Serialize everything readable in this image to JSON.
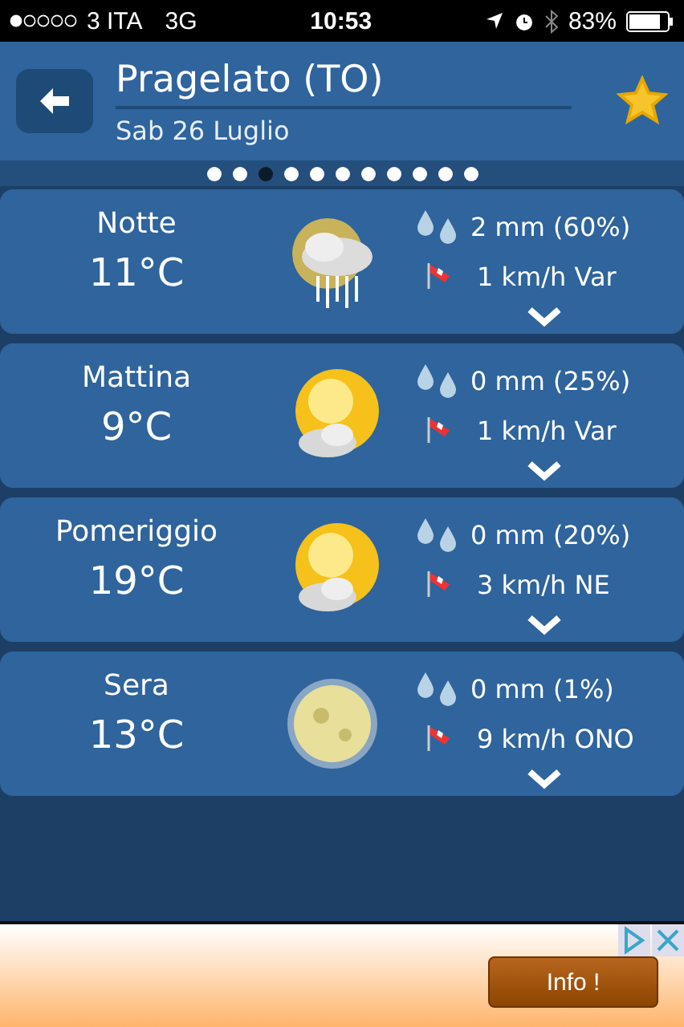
{
  "status_bar": {
    "carrier": "3 ITA",
    "network": "3G",
    "time": "10:53",
    "battery": "83%"
  },
  "header": {
    "title": "Pragelato (TO)",
    "date": "Sab 26 Luglio",
    "favorite": true
  },
  "pages": [
    {
      "selected": false
    },
    {
      "selected": false
    },
    {
      "selected": true
    },
    {
      "selected": false
    },
    {
      "selected": false
    },
    {
      "selected": false
    },
    {
      "selected": false
    },
    {
      "selected": false
    },
    {
      "selected": false
    },
    {
      "selected": false
    },
    {
      "selected": false
    }
  ],
  "periods": [
    {
      "name": "Notte",
      "temperature": "11°C",
      "kind": "moon-rain",
      "rain": "2 mm (60%)",
      "wind": "1 km/h Var"
    },
    {
      "name": "Mattina",
      "temperature": "9°C",
      "kind": "sun-cloud",
      "rain": "0 mm (25%)",
      "wind": "1 km/h Var"
    },
    {
      "name": "Pomeriggio",
      "temperature": "19°C",
      "kind": "sun-cloud",
      "rain": "0 mm (20%)",
      "wind": "3 km/h NE"
    },
    {
      "name": "Sera",
      "temperature": "13°C",
      "kind": "moon-haze",
      "rain": "0 mm (1%)",
      "wind": "9 km/h ONO"
    }
  ],
  "ad": {
    "button": "Info !"
  }
}
